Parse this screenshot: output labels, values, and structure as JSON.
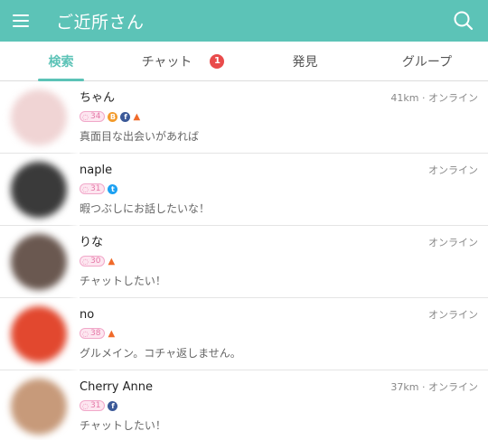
{
  "app": {
    "title": "ご近所さん",
    "accent": "#5cc3b7"
  },
  "icons": {
    "menu": "hamburger-icon",
    "search": "search-icon"
  },
  "tabs": [
    {
      "label": "検索",
      "active": true
    },
    {
      "label": "チャット",
      "badge": "1"
    },
    {
      "label": "発見"
    },
    {
      "label": "グループ"
    }
  ],
  "users": [
    {
      "name": "ちゃん",
      "meta": "41km · オンライン",
      "age": "34",
      "icons": [
        "orange-coin-icon",
        "facebook-icon",
        "flame-icon"
      ],
      "message": "真面目な出会いがあれば",
      "avatar": "#f0d4d4"
    },
    {
      "name": "naple",
      "meta": "オンライン",
      "age": "31",
      "icons": [
        "twitter-icon"
      ],
      "message": "暇つぶしにお話したいな！",
      "avatar": "#3a3a3a"
    },
    {
      "name": "りな",
      "meta": "オンライン",
      "age": "30",
      "icons": [
        "flame-icon"
      ],
      "message": "チャットしたい！",
      "avatar": "#6a5850"
    },
    {
      "name": "no",
      "meta": "オンライン",
      "age": "38",
      "icons": [
        "flame-icon"
      ],
      "message": "グルメイン。コチャ返しません。",
      "avatar": "#e2482f"
    },
    {
      "name": "Cherry Anne",
      "meta": "37km · オンライン",
      "age": "31",
      "icons": [
        "facebook-icon"
      ],
      "message": "チャットしたい！",
      "avatar": "#c79a7a"
    }
  ]
}
